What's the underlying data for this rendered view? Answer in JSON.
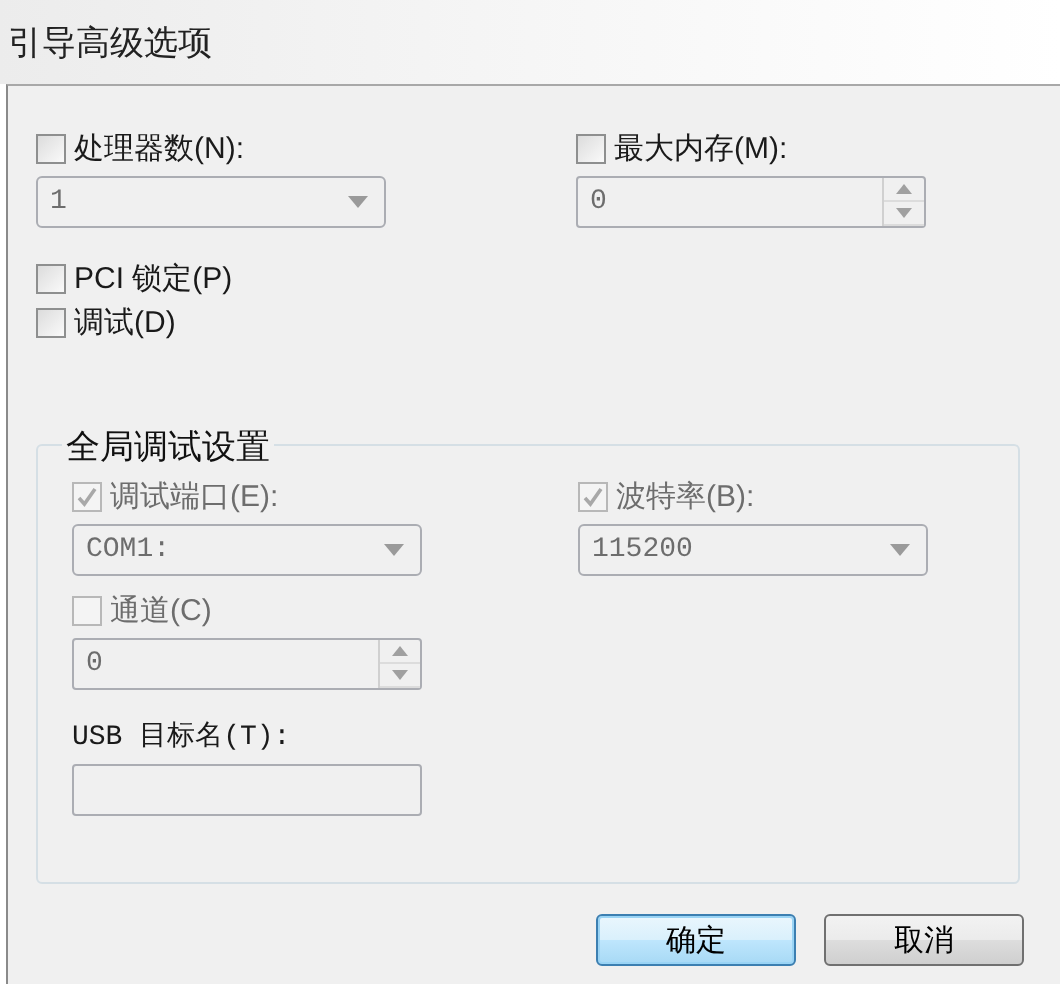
{
  "window": {
    "title": "引导高级选项"
  },
  "rows": [
    [
      {
        "kind": "check-field",
        "check": {
          "label": "处理器数(N):",
          "checked": false,
          "disabled": false
        },
        "field": {
          "kind": "combo",
          "value": "1",
          "disabled": true
        }
      },
      {
        "kind": "check-field",
        "check": {
          "label": "最大内存(M):",
          "checked": false,
          "disabled": false
        },
        "field": {
          "kind": "spin",
          "value": "0",
          "disabled": true
        }
      }
    ],
    [
      {
        "kind": "check",
        "check": {
          "label": "PCI 锁定(P)",
          "checked": false,
          "disabled": false
        }
      }
    ],
    [
      {
        "kind": "check",
        "check": {
          "label": "调试(D)",
          "checked": false,
          "disabled": false
        }
      }
    ]
  ],
  "group": {
    "title": "全局调试设置",
    "rows": [
      [
        {
          "kind": "check-field",
          "check": {
            "label": "调试端口(E):",
            "checked": true,
            "disabled": true
          },
          "field": {
            "kind": "combo",
            "value": "COM1:",
            "disabled": true
          }
        },
        {
          "kind": "check-field",
          "check": {
            "label": "波特率(B):",
            "checked": true,
            "disabled": true
          },
          "field": {
            "kind": "combo",
            "value": "115200",
            "disabled": true
          }
        }
      ],
      [
        {
          "kind": "check-field",
          "check": {
            "label": "通道(C)",
            "checked": false,
            "disabled": true
          },
          "field": {
            "kind": "spin",
            "value": "0",
            "disabled": true
          }
        }
      ],
      [
        {
          "kind": "label-field",
          "label": "USB 目标名(T):",
          "field": {
            "kind": "text",
            "disabled": true
          }
        }
      ]
    ]
  },
  "buttons": [
    {
      "label": "确定",
      "default": true
    },
    {
      "label": "取消",
      "default": false
    }
  ]
}
